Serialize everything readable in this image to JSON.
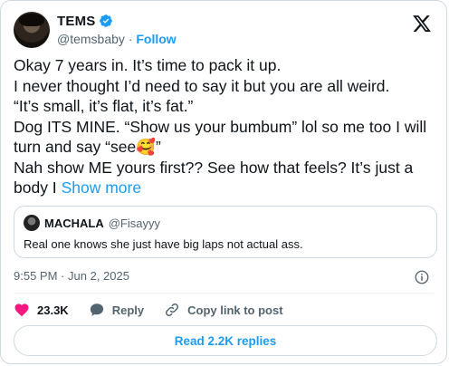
{
  "author": {
    "name": "TEMS",
    "handle": "@temsbaby",
    "separator": "·",
    "follow_label": "Follow"
  },
  "icons": {
    "verified": "verified-badge-icon",
    "brand": "x-logo-icon",
    "info": "info-icon",
    "like": "heart-icon",
    "reply": "reply-bubble-icon",
    "copy_link": "link-icon"
  },
  "colors": {
    "accent": "#1d9bf0",
    "like": "#f91880",
    "text": "#0f1419",
    "muted": "#536471"
  },
  "tweet": {
    "line1": "Okay 7 years in. It’s time to pack it up.",
    "line2": "I never thought I’d need to say it but you are all weird.",
    "line3": "“It’s small, it’s flat, it’s fat.”",
    "line4": "Dog ITS MINE. “Show us your bumbum” lol so me too I will turn and say “see",
    "emoji": "🥰",
    "line4_end": "”",
    "line5": "Nah show ME yours first?? See how that feels? It’s just a body I",
    "show_more": "Show more"
  },
  "quote": {
    "name": "MACHALA",
    "handle": "@Fisayyy",
    "text": "Real one knows she just have big laps not actual ass."
  },
  "meta": {
    "time": "9:55 PM",
    "separator": "·",
    "date": "Jun 2, 2025"
  },
  "actions": {
    "likes": "23.3K",
    "reply_label": "Reply",
    "copy_link_label": "Copy link to post"
  },
  "read_replies_label": "Read 2.2K replies"
}
